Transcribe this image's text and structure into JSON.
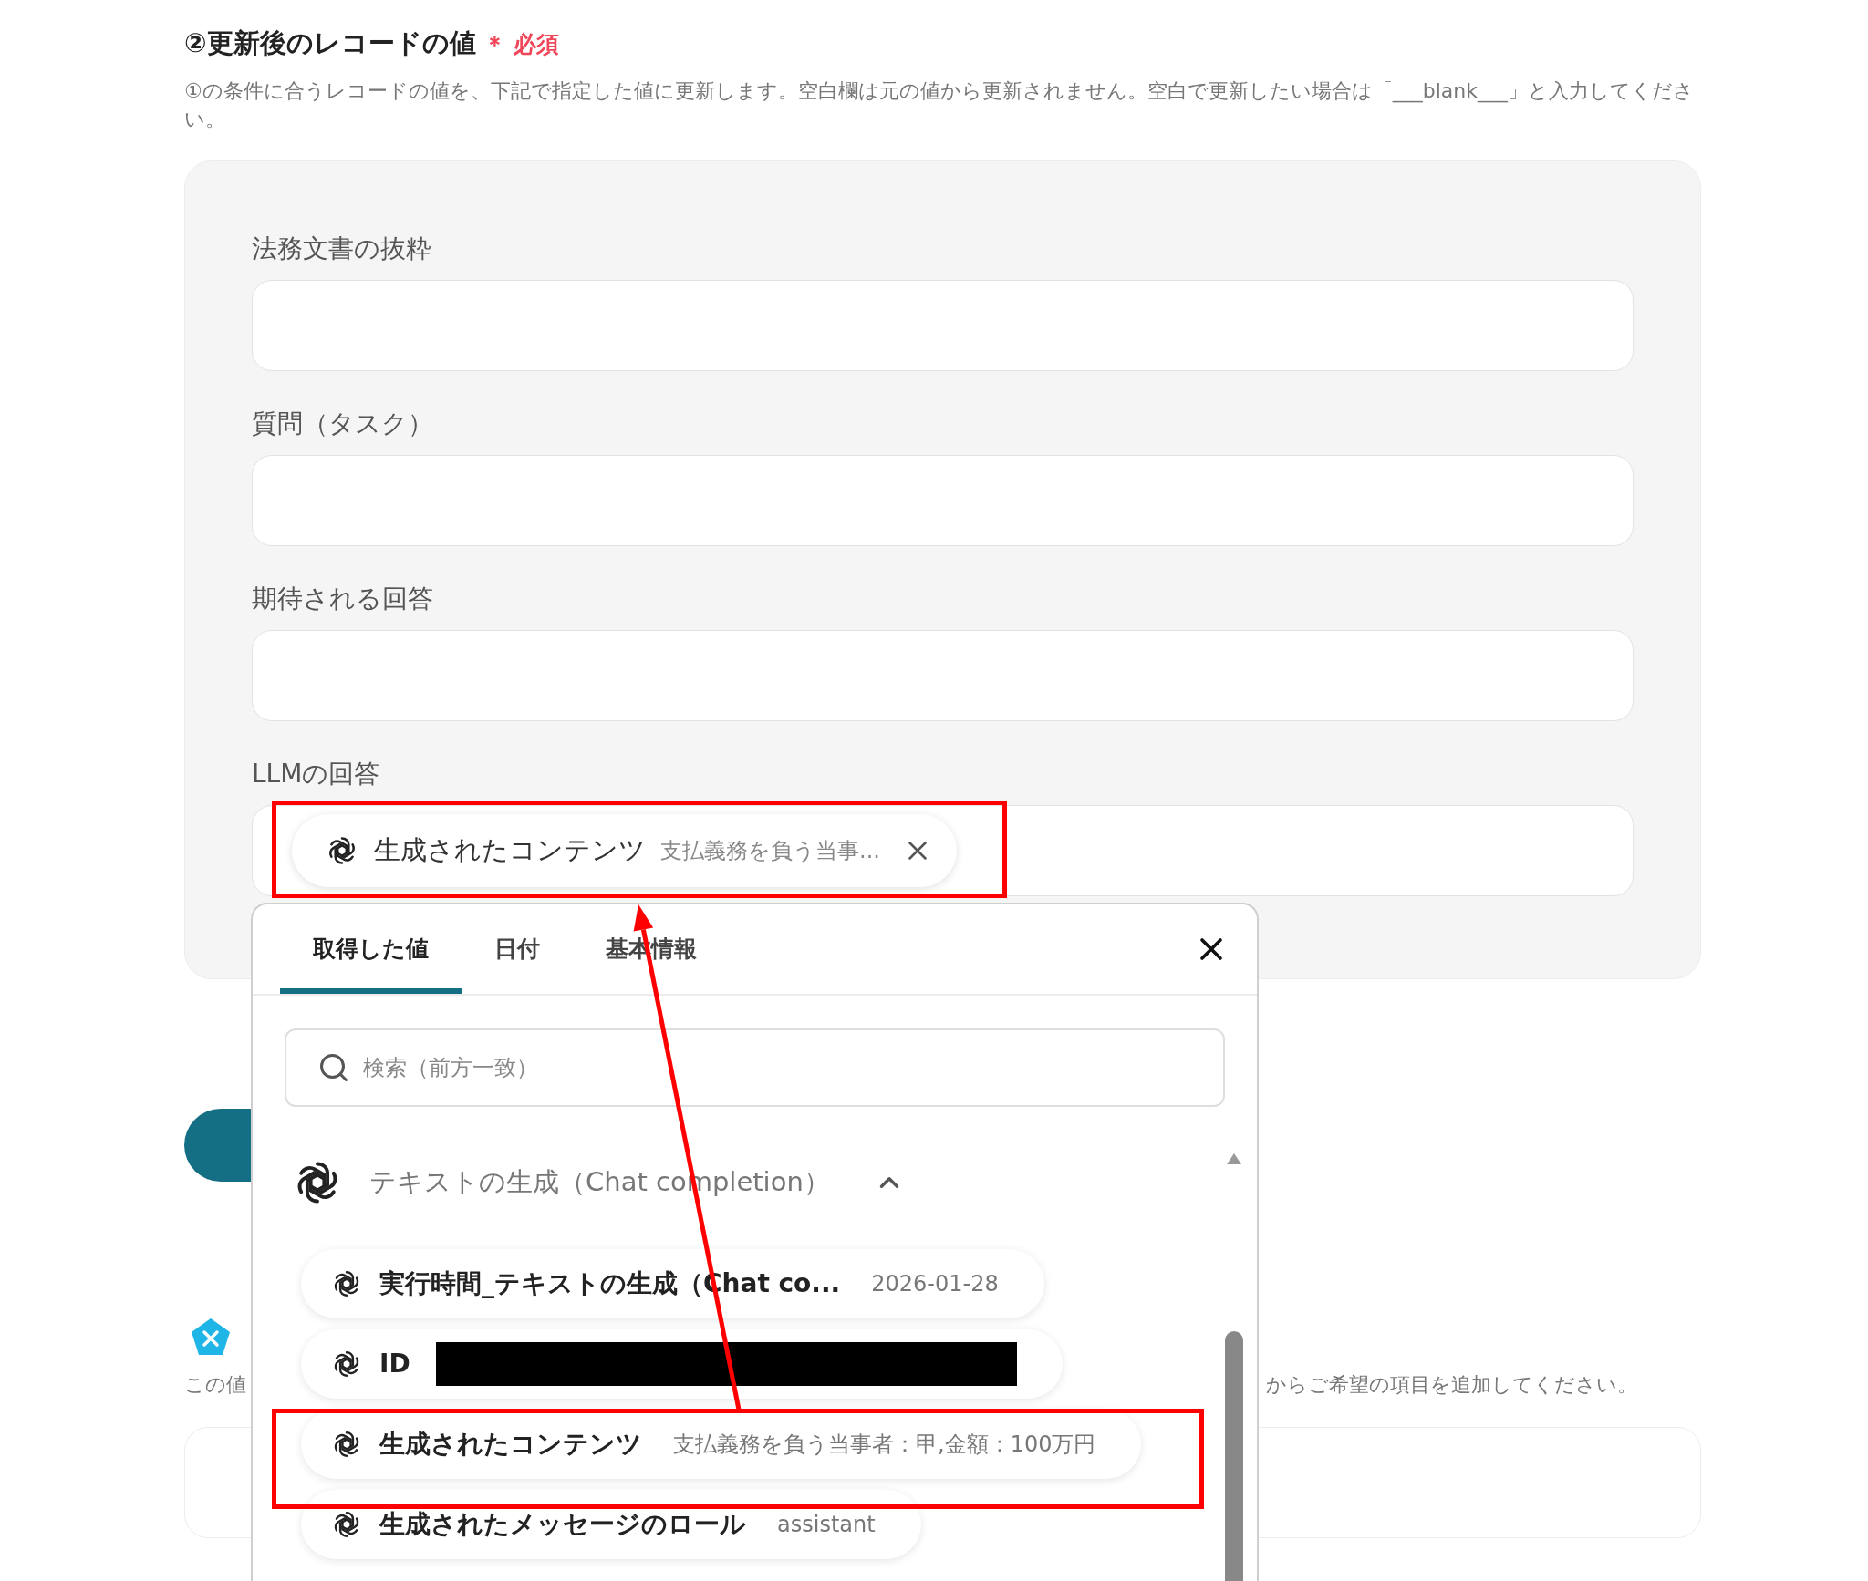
{
  "section": {
    "title": "②更新後のレコードの値",
    "required_mark": "＊ 必須",
    "description": "①の条件に合うレコードの値を、下記で指定した値に更新します。空白欄は元の値から更新されません。空白で更新したい場合は「___blank___」と入力してください。"
  },
  "fields": [
    {
      "label": "法務文書の抜粋"
    },
    {
      "label": "質問（タスク）"
    },
    {
      "label": "期待される回答"
    },
    {
      "label": "LLMの回答",
      "token": {
        "name": "生成されたコンテンツ",
        "value": "支払義務を負う当事..."
      }
    }
  ],
  "below": {
    "info_start": "この値",
    "info_end": "からご希望の項目を追加してください。"
  },
  "popup": {
    "tabs": [
      {
        "label": "取得した値",
        "selected": true
      },
      {
        "label": "日付",
        "selected": false
      },
      {
        "label": "基本情報",
        "selected": false
      }
    ],
    "search": {
      "placeholder": "検索（前方一致）"
    },
    "group": {
      "title": "テキストの生成（Chat completion）",
      "expanded": true,
      "items": [
        {
          "name": "実行時間_テキストの生成（Chat co...",
          "value": "2026-01-28",
          "redacted": false
        },
        {
          "name": "ID",
          "redacted": true
        },
        {
          "name": "生成されたコンテンツ",
          "value": "支払義務を負う当事者：甲,金額：100万円",
          "redacted": false
        },
        {
          "name": "生成されたメッセージのロール",
          "value": "assistant",
          "redacted": false
        }
      ]
    }
  }
}
